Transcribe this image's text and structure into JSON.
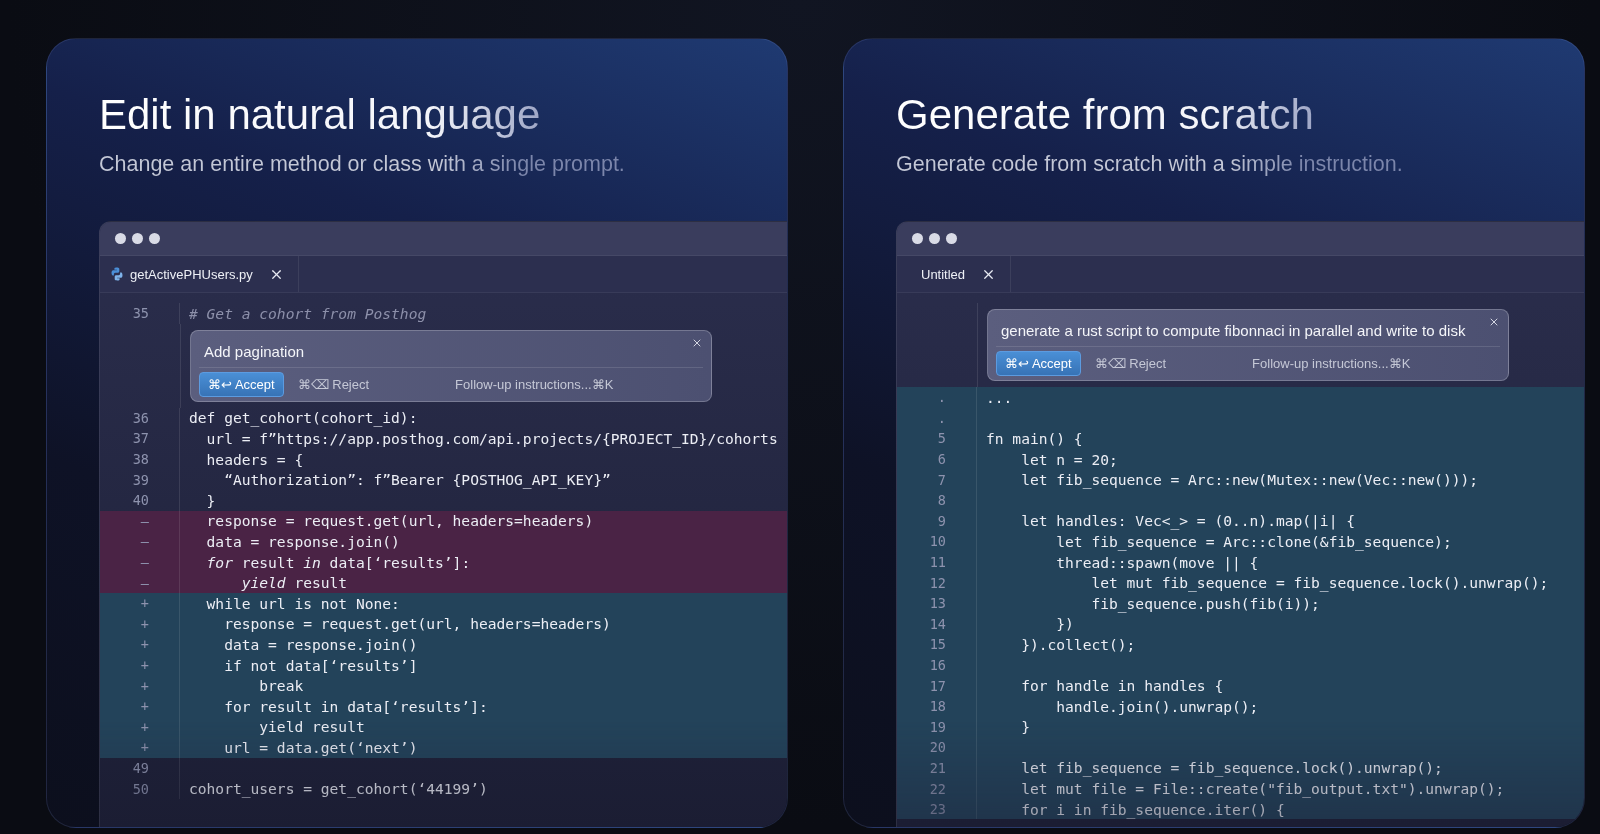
{
  "cards": [
    {
      "title": "Edit in natural language",
      "subtitle": "Change an entire method or class with a single prompt.",
      "editor": {
        "tab": {
          "label": "getActivePHUsers.py",
          "kind": "python"
        },
        "lines_before": [
          {
            "kind": "comment",
            "gutter": "35",
            "text": "# Get a cohort from Posthog"
          }
        ],
        "prompt": {
          "text": "Add pagination",
          "accept": "⌘↩ Accept",
          "reject": "⌘⌫ Reject",
          "followup": "Follow-up instructions...⌘K"
        },
        "lines_after": [
          {
            "kind": "normal",
            "gutter": "36",
            "text": "def get_cohort(cohort_id):"
          },
          {
            "kind": "normal",
            "gutter": "37",
            "text": "  url = f”https://app.posthog.com/api.projects/{PROJECT_ID}/cohorts"
          },
          {
            "kind": "normal",
            "gutter": "38",
            "text": "  headers = {"
          },
          {
            "kind": "normal",
            "gutter": "39",
            "text": "    “Authorization”: f”Bearer {POSTHOG_API_KEY}”"
          },
          {
            "kind": "normal",
            "gutter": "40",
            "text": "  }"
          },
          {
            "kind": "removed",
            "gutter": "–",
            "text": "  response = request.get(url, headers=headers)"
          },
          {
            "kind": "removed",
            "gutter": "–",
            "text": "  data = response.join()"
          },
          {
            "kind": "removed",
            "gutter": "–",
            "text": "  *for* result *in* data[‘results’]:"
          },
          {
            "kind": "removed",
            "gutter": "–",
            "text": "      *yield* result"
          },
          {
            "kind": "added",
            "gutter": "+",
            "text": "  while url is not None:"
          },
          {
            "kind": "added",
            "gutter": "+",
            "text": "    response = request.get(url, headers=headers)"
          },
          {
            "kind": "added",
            "gutter": "+",
            "text": "    data = response.join()"
          },
          {
            "kind": "added",
            "gutter": "+",
            "text": "    if not data[‘results’]"
          },
          {
            "kind": "added",
            "gutter": "+",
            "text": "        break"
          },
          {
            "kind": "added",
            "gutter": "+",
            "text": "    for result in data[‘results’]:"
          },
          {
            "kind": "added",
            "gutter": "+",
            "text": "        yield result"
          },
          {
            "kind": "added",
            "gutter": "+",
            "text": "    url = data.get(‘next’)"
          },
          {
            "kind": "normal",
            "gutter": "49"
          },
          {
            "kind": "normal",
            "gutter": "50",
            "text": "cohort_users = get_cohort(‘44199’)"
          }
        ]
      }
    },
    {
      "title": "Generate from scratch",
      "subtitle": "Generate code from scratch with a simple instruction.",
      "editor": {
        "tab": {
          "label": "Untitled",
          "kind": "plain"
        },
        "prompt": {
          "text": "generate a rust script to compute fibonnaci in parallel and write to disk",
          "accept": "⌘↩ Accept",
          "reject": "⌘⌫ Reject",
          "followup": "Follow-up instructions...⌘K"
        },
        "lines_after": [
          {
            "kind": "added",
            "gutter": ".",
            "text": "..."
          },
          {
            "kind": "added",
            "gutter": "."
          },
          {
            "kind": "added",
            "gutter": "5",
            "text": "fn main() {"
          },
          {
            "kind": "added",
            "gutter": "6",
            "text": "    let n = 20;"
          },
          {
            "kind": "added",
            "gutter": "7",
            "text": "    let fib_sequence = Arc::new(Mutex::new(Vec::new()));"
          },
          {
            "kind": "added",
            "gutter": "8"
          },
          {
            "kind": "added",
            "gutter": "9",
            "text": "    let handles: Vec<_> = (0..n).map(|i| {"
          },
          {
            "kind": "added",
            "gutter": "10",
            "text": "        let fib_sequence = Arc::clone(&fib_sequence);"
          },
          {
            "kind": "added",
            "gutter": "11",
            "text": "        thread::spawn(move || {"
          },
          {
            "kind": "added",
            "gutter": "12",
            "text": "            let mut fib_sequence = fib_sequence.lock().unwrap();"
          },
          {
            "kind": "added",
            "gutter": "13",
            "text": "            fib_sequence.push(fib(i));"
          },
          {
            "kind": "added",
            "gutter": "14",
            "text": "        })"
          },
          {
            "kind": "added",
            "gutter": "15",
            "text": "    }).collect();"
          },
          {
            "kind": "added",
            "gutter": "16"
          },
          {
            "kind": "added",
            "gutter": "17",
            "text": "    for handle in handles {"
          },
          {
            "kind": "added",
            "gutter": "18",
            "text": "        handle.join().unwrap();"
          },
          {
            "kind": "added",
            "gutter": "19",
            "text": "    }"
          },
          {
            "kind": "added",
            "gutter": "20"
          },
          {
            "kind": "added",
            "gutter": "21",
            "text": "    let fib_sequence = fib_sequence.lock().unwrap();"
          },
          {
            "kind": "added",
            "gutter": "22",
            "text": "    let mut file = File::create(\"fib_output.txt\").unwrap();"
          },
          {
            "kind": "added",
            "gutter": "23",
            "text": "    for i in fib_sequence.iter() {"
          }
        ]
      }
    }
  ]
}
